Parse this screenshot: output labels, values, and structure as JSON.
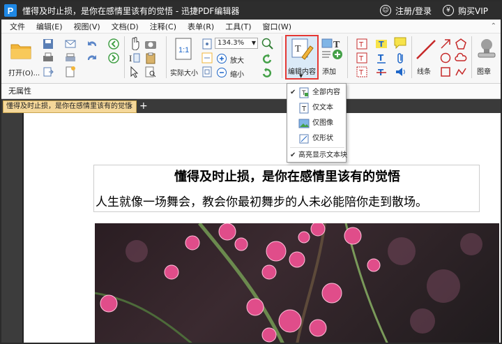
{
  "titlebar": {
    "logo_letter": "P",
    "title": "懂得及时止损，是你在感情里该有的觉悟 - 迅捷PDF编辑器",
    "login": "注册/登录",
    "vip": "购买VIP"
  },
  "menu": [
    "文件",
    "编辑(E)",
    "视图(V)",
    "文档(D)",
    "注释(C)",
    "表单(R)",
    "工具(T)",
    "窗口(W)"
  ],
  "ribbon": {
    "open_label": "打开(O)...",
    "actual_size": "实际大小",
    "zoom_value": "134.3%",
    "zoom_in": "放大",
    "zoom_out": "缩小",
    "edit_content": "编辑内容",
    "add": "添加",
    "line": "线条",
    "stamp": "图章"
  },
  "properties": {
    "label": "无属性"
  },
  "tab": {
    "title": "懂得及时止损，是你在感情里该有的觉悟",
    "close": "×",
    "add": "+"
  },
  "dropdown": {
    "items": [
      "全部内容",
      "仅文本",
      "仅图像",
      "仅形状",
      "高亮显示文本块"
    ],
    "checked": [
      "全部内容",
      "高亮显示文本块"
    ]
  },
  "document": {
    "title": "懂得及时止损，是你在感情里该有的觉悟",
    "body": "人生就像一场舞会，教会你最初舞步的人未必能陪你走到散场。"
  },
  "colors": {
    "accent": "#e53935",
    "tab_bg": "#f5d89a",
    "titlebar_bg": "#2d2d2d"
  }
}
